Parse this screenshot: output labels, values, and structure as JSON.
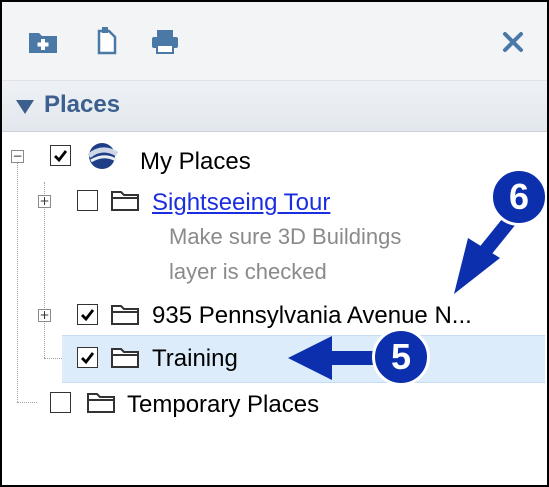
{
  "toolbar": {
    "add_icon": "add-folder-icon",
    "doc_icon": "document-icon",
    "print_icon": "print-icon",
    "close_icon": "close-icon"
  },
  "panel": {
    "title": "Places"
  },
  "tree": {
    "root": {
      "label": "My Places",
      "checked": true
    },
    "items": [
      {
        "label": "Sightseeing Tour",
        "checked": false,
        "link": true,
        "description_line1": "Make sure 3D Buildings",
        "description_line2": "layer is checked"
      },
      {
        "label": "935 Pennsylvania Avenue N...",
        "checked": true
      },
      {
        "label": "Training",
        "checked": true,
        "selected": true
      }
    ],
    "temporary": {
      "label": "Temporary Places",
      "checked": false
    }
  },
  "callouts": {
    "step5": "5",
    "step6": "6"
  },
  "colors": {
    "accent": "#0c2fae",
    "header_text": "#3c5f8e",
    "link": "#1a2ee0",
    "selection": "#dcecfb"
  }
}
